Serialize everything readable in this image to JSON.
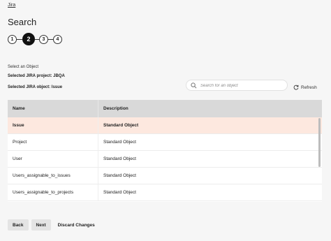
{
  "breadcrumb": "Jira",
  "title": "Search",
  "steps": [
    "1",
    "2",
    "3",
    "4"
  ],
  "active_step": 2,
  "section_label": "Select an Object",
  "selected_project": "Selected JIRA project: JBQA",
  "selected_object": "Selected JIRA object: Issue",
  "search": {
    "placeholder": "Search for an object",
    "value": ""
  },
  "refresh_label": "Refresh",
  "table": {
    "headers": [
      "Name",
      "Description"
    ],
    "rows": [
      {
        "name": "Issue",
        "description": "Standard Object",
        "selected": true
      },
      {
        "name": "Project",
        "description": "Standard Object"
      },
      {
        "name": "User",
        "description": "Standard Object"
      },
      {
        "name": "Users_assignable_to_issues",
        "description": "Standard Object"
      },
      {
        "name": "Users_assignable_to_projects",
        "description": "Standard Object"
      }
    ]
  },
  "buttons": {
    "back": "Back",
    "next": "Next",
    "discard": "Discard Changes"
  },
  "colors": {
    "selected_row": "#fde8df",
    "header_bg": "#d9d9d9",
    "active_step": "#111111"
  },
  "icons": {
    "search": "search-icon",
    "refresh": "refresh-icon"
  }
}
